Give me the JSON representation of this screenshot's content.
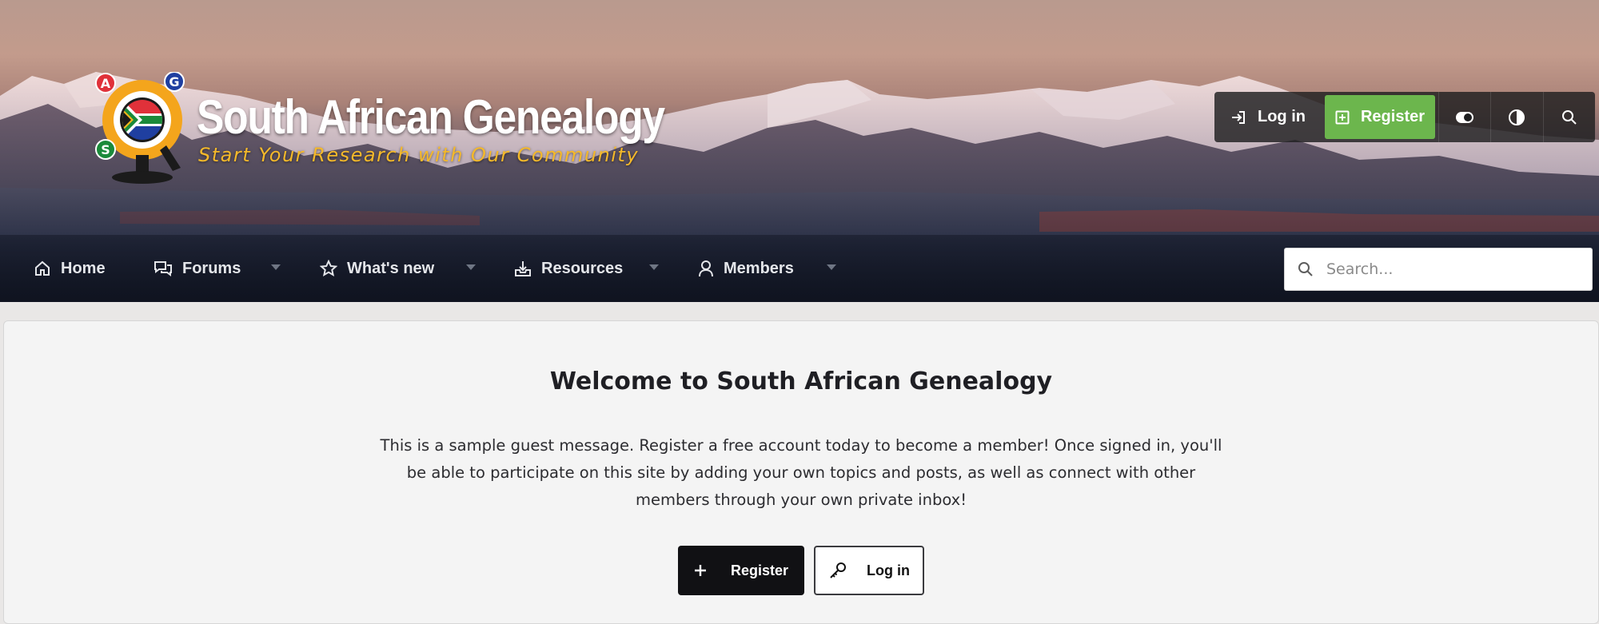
{
  "site": {
    "title": "South African Genealogy",
    "tagline": "Start Your Research with Our Community",
    "logo_letters": [
      "A",
      "G",
      "S"
    ]
  },
  "topbar": {
    "login_label": "Log in",
    "register_label": "Register",
    "icons": [
      "style-toggle-icon",
      "contrast-icon",
      "search-icon"
    ]
  },
  "nav": {
    "items": [
      {
        "label": "Home",
        "icon": "home-icon",
        "has_menu": false
      },
      {
        "label": "Forums",
        "icon": "chat-bubbles-icon",
        "has_menu": true
      },
      {
        "label": "What's new",
        "icon": "star-icon",
        "has_menu": true
      },
      {
        "label": "Resources",
        "icon": "download-tray-icon",
        "has_menu": true
      },
      {
        "label": "Members",
        "icon": "user-icon",
        "has_menu": true
      }
    ],
    "search_placeholder": "Search..."
  },
  "notice": {
    "title": "Welcome to South African Genealogy",
    "body": "This is a sample guest message. Register a free account today to become a member! Once signed in, you'll be able to participate on this site by adding your own topics and posts, as well as connect with other members through your own private inbox!",
    "register_label": "Register",
    "login_label": "Log in"
  },
  "colors": {
    "register_accent": "#6cb64d",
    "tagline": "#f5b92a",
    "primary_button": "#111114"
  }
}
